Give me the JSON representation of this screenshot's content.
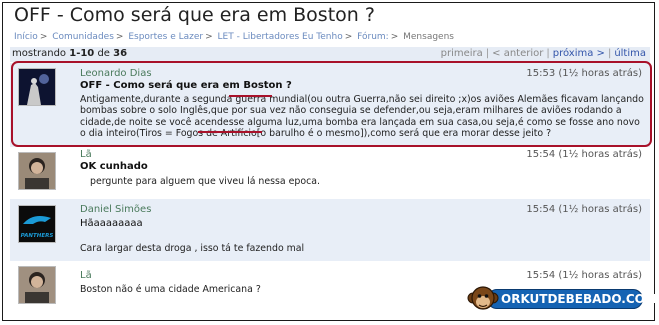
{
  "page": {
    "title": "OFF - Como será que era em Boston ?",
    "breadcrumbs": [
      "Início",
      "Comunidades",
      "Esportes e Lazer",
      "LET - Libertadores Eu Tenho",
      "Fórum:",
      "Mensagens"
    ]
  },
  "pager": {
    "showing_label": "mostrando",
    "range": "1-10",
    "of_label": "de",
    "total": "36",
    "first": "primeira",
    "previous": "< anterior",
    "next": "próxima >",
    "last": "última"
  },
  "posts": [
    {
      "author": "Leonardo Dias",
      "time": "15:53 (1½ horas atrás)",
      "subject": "OFF - Como será que era em Boston ?",
      "body": "Antigamente,durante a segunda guerra mundial(ou outra Guerra,não sei direito ;x)os aviões Alemães ficavam lançando bombas sobre o solo Inglês,que por sua vez não conseguia se defender,ou seja,eram milhares de aviões rodando a cidade,de noite se você acendesse alguma luz,uma bomba era lançada em sua casa,ou seja,é como se fosse ano novo o dia inteiro(Tiros = Fogos de Artifício[o barulho é o mesmo]),como será que era morar desse jeito ?"
    },
    {
      "author": "Lã",
      "time": "15:54 (1½ horas atrás)",
      "subject": "OK cunhado",
      "body": "pergunte para alguem que viveu lá nessa epoca."
    },
    {
      "author": "Daniel Simões",
      "time": "15:54 (1½ horas atrás)",
      "subject": "Hãaaaaaaaa",
      "body": "Cara largar desta droga , isso tá te fazendo mal"
    },
    {
      "author": "Lã",
      "time": "15:54 (1½ horas atrás)",
      "subject": "",
      "body": "Boston não é uma cidade Americana ?"
    }
  ],
  "avatars": {
    "avatar_1": "night-scene-avatar",
    "avatar_2": "person-photo-avatar",
    "avatar_3": "panthers-logo-avatar",
    "avatar_4": "person-photo-avatar"
  },
  "panthers_text": "PANTHERS",
  "brand": {
    "text": "ORKUTDEBEBADO.COM"
  },
  "colors": {
    "highlight": "#a8112a",
    "link": "#3355aa",
    "author": "#4a7a5c",
    "pager_bg": "#e6ecf5",
    "brand_blue": "#1563b3"
  }
}
